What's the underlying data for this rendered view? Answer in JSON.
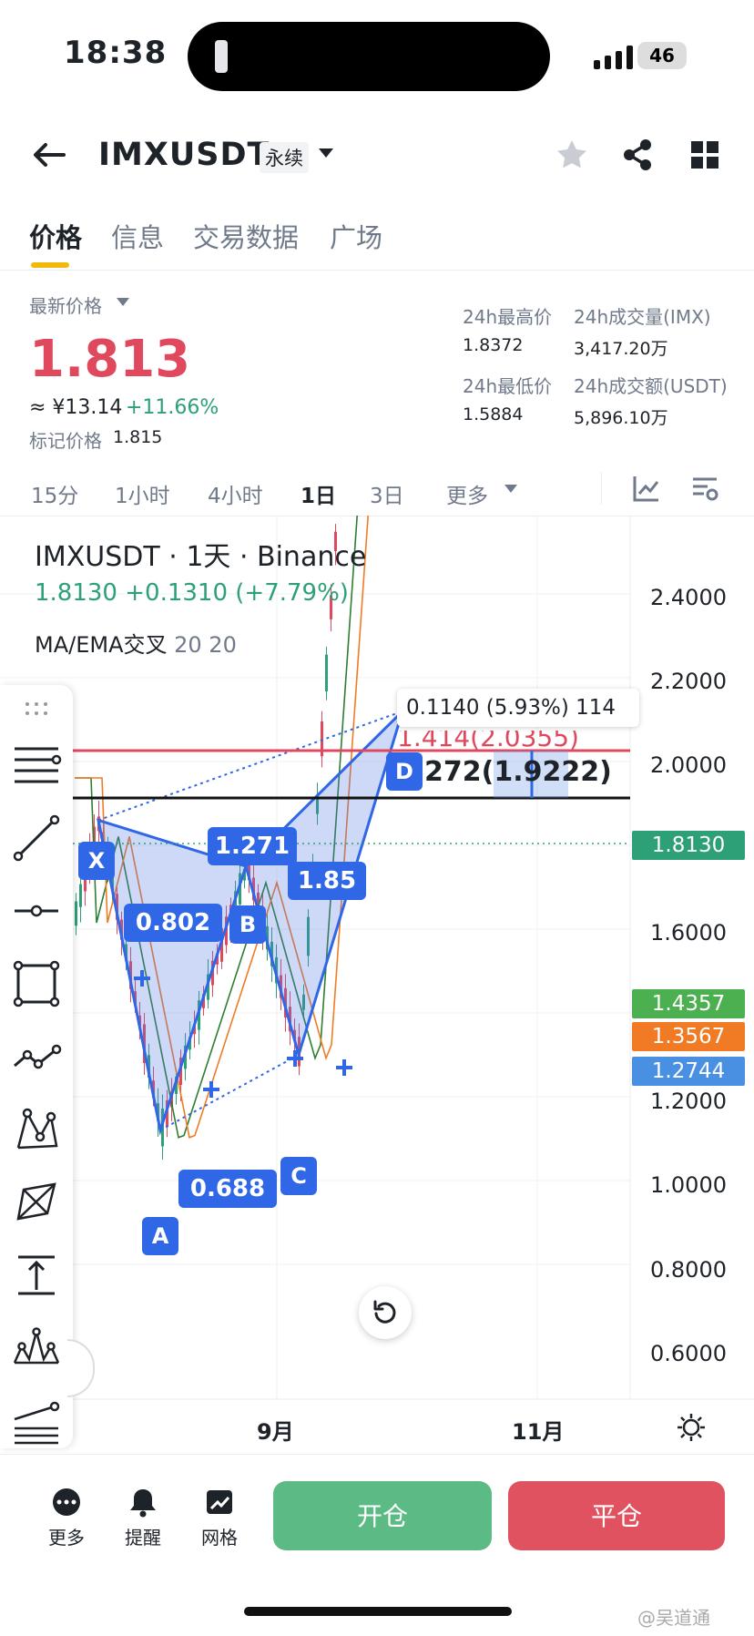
{
  "status": {
    "time": "18:38",
    "battery": "46"
  },
  "header": {
    "symbol": "IMXUSDT",
    "contract_type": "永续"
  },
  "tabs": [
    "价格",
    "信息",
    "交易数据",
    "广场"
  ],
  "price": {
    "latest_label": "最新价格",
    "last": "1.813",
    "cny": "≈ ¥13.14",
    "change_pct": "+11.66%",
    "mark_label": "标记价格",
    "mark": "1.815"
  },
  "stats": {
    "high_label": "24h最高价",
    "high": "1.8372",
    "low_label": "24h最低价",
    "low": "1.5884",
    "vol_label": "24h成交量(IMX)",
    "vol": "3,417.20万",
    "amt_label": "24h成交额(USDT)",
    "amt": "5,896.10万"
  },
  "intervals": [
    "15分",
    "1小时",
    "4小时",
    "1日",
    "3日",
    "更多"
  ],
  "chart_data": {
    "type": "line",
    "title": "IMXUSDT · 1天 · Binance",
    "last_close": "1.8130",
    "change": "+0.1310",
    "change_pct": "(+7.79%)",
    "indicator_name": "MA/EMA交叉",
    "indicator_params": "20 20",
    "y_ticks": [
      "2.4000",
      "2.2000",
      "2.0000",
      "1.6000",
      "1.2000",
      "1.0000",
      "0.8000",
      "0.6000"
    ],
    "x_ticks": [
      "9月",
      "11月"
    ],
    "price_tags": [
      {
        "label": "1.8130",
        "color": "#2ea078"
      },
      {
        "label": "1.4357",
        "color": "#4caf50"
      },
      {
        "label": "1.3567",
        "color": "#f07b24"
      },
      {
        "label": "1.2744",
        "color": "#4a90e2"
      }
    ],
    "pattern": {
      "points": [
        {
          "name": "X",
          "price": 1.66
        },
        {
          "name": "A",
          "price": 0.92
        },
        {
          "name": "B",
          "price": 1.55
        },
        {
          "name": "C",
          "price": 1.1
        },
        {
          "name": "D",
          "price": 1.92
        }
      ],
      "ratios": [
        "0.802",
        "0.688",
        "1.271",
        "1.85"
      ],
      "target_text": "272(1.9222)",
      "measure_text": "0.1140 (5.93%) 114",
      "partial_level_text": "1.414(2.0355)"
    }
  },
  "bottom": {
    "more": "更多",
    "alert": "提醒",
    "grid": "网格",
    "open": "开仓",
    "close": "平仓"
  },
  "colors": {
    "up": "#2ea078",
    "down": "#e0485d",
    "accent": "#f0b90b",
    "pattern": "#2f67e7"
  },
  "watermark": "@吴道通"
}
